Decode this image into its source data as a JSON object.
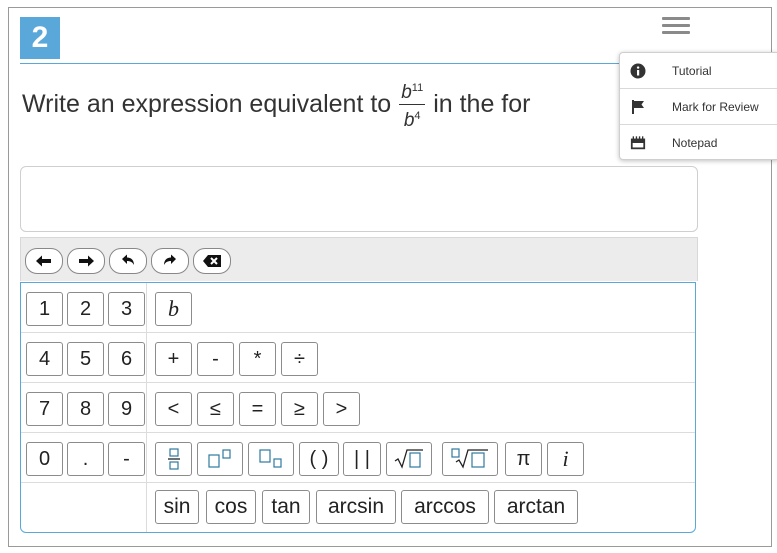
{
  "question": {
    "number": "2",
    "text_before": "Write an expression equivalent to",
    "fraction": {
      "base_num": "b",
      "exp_num": "11",
      "base_den": "b",
      "exp_den": "4"
    },
    "text_after": "in the for"
  },
  "menu": {
    "icon": "hamburger-menu-icon",
    "items": [
      {
        "label": "Tutorial",
        "icon": "info-icon"
      },
      {
        "label": "Mark for Review",
        "icon": "flag-icon"
      },
      {
        "label": "Notepad",
        "icon": "notepad-icon"
      }
    ]
  },
  "answer": {
    "value": ""
  },
  "toolbar": {
    "buttons": [
      "left-arrow-icon",
      "right-arrow-icon",
      "undo-icon",
      "redo-icon",
      "delete-icon"
    ]
  },
  "keypad": {
    "numbers": [
      "1",
      "2",
      "3",
      "4",
      "5",
      "6",
      "7",
      "8",
      "9",
      "0",
      ".",
      "-"
    ],
    "variable": "b",
    "operators": [
      "+",
      "-",
      "*",
      "÷"
    ],
    "comparisons": [
      "<",
      "≤",
      "=",
      "≥",
      ">"
    ],
    "specials": {
      "parentheses": "( )",
      "absolute_value": "| |",
      "pi": "π",
      "imaginary": "i"
    },
    "functions": [
      "sin",
      "cos",
      "tan",
      "arcsin",
      "arccos",
      "arctan"
    ]
  },
  "colors": {
    "accent": "#5aa8d9",
    "border": "#8c8c8c",
    "toolbar_bg": "#ececec"
  }
}
